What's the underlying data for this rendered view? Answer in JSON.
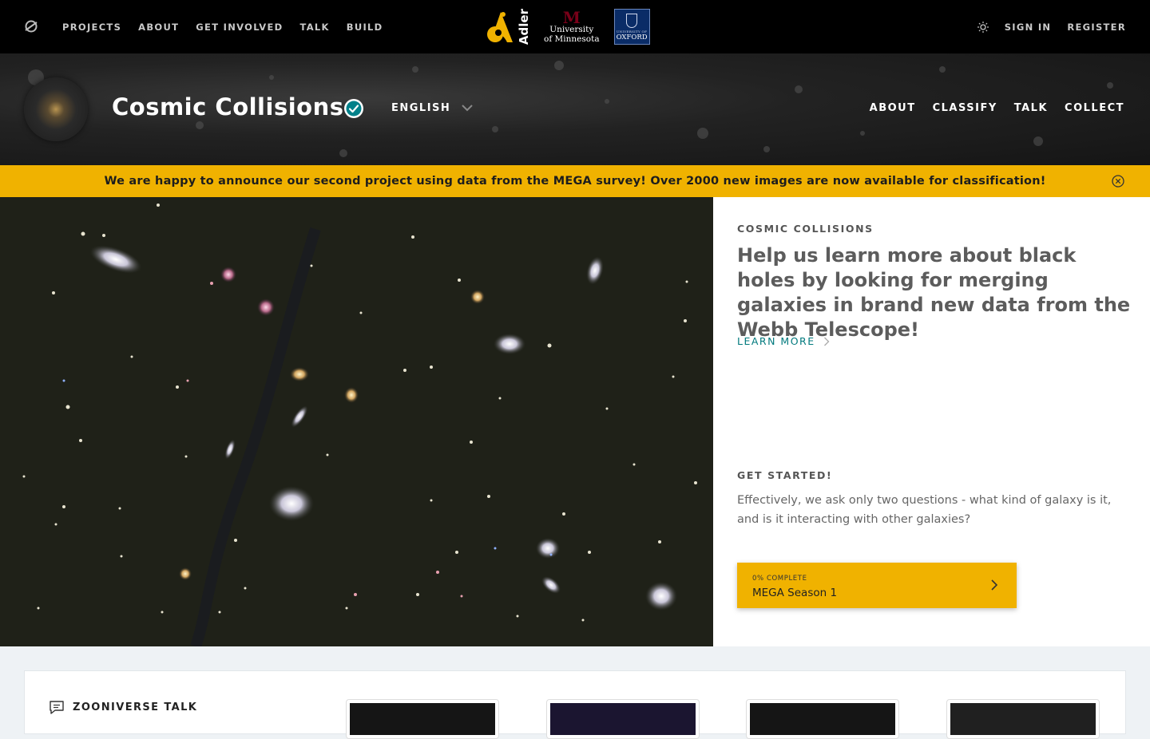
{
  "topbar": {
    "logo_icon": "zooniverse-logo-icon",
    "nav": [
      "PROJECTS",
      "ABOUT",
      "GET INVOLVED",
      "TALK",
      "BUILD"
    ],
    "partners": {
      "adler": "Adler",
      "umn_line1": "University",
      "umn_line2": "of Minnesota",
      "oxford_small": "UNIVERSITY OF",
      "oxford_big": "OXFORD"
    },
    "theme_icon": "sun-icon",
    "sign_in": "SIGN IN",
    "register": "REGISTER"
  },
  "project": {
    "title": "Cosmic Collisions",
    "verified_icon": "verified-check-icon",
    "language": "ENGLISH",
    "nav": [
      "ABOUT",
      "CLASSIFY",
      "TALK",
      "COLLECT"
    ]
  },
  "announcement": {
    "text": "We are happy to announce our second project using data from the MEGA survey! Over 2000 new images are now available for classification!",
    "close_icon": "close-circle-icon"
  },
  "intro": {
    "kicker": "COSMIC COLLISIONS",
    "description": "Help us learn more about black holes by looking for merging galaxies in brand new data from the Webb Telescope!",
    "learn_more": "LEARN MORE",
    "get_started_title": "GET STARTED!",
    "get_started_text": "Effectively, we ask only two questions - what kind of galaxy is it, and is it interacting with other galaxies?",
    "workflow": {
      "progress": "0% COMPLETE",
      "name": "MEGA Season 1"
    }
  },
  "talk": {
    "label": "ZOONIVERSE TALK",
    "icon": "speech-bubble-icon"
  },
  "colors": {
    "accent": "#f0b200",
    "link": "#00797d",
    "topbar": "#000000"
  }
}
